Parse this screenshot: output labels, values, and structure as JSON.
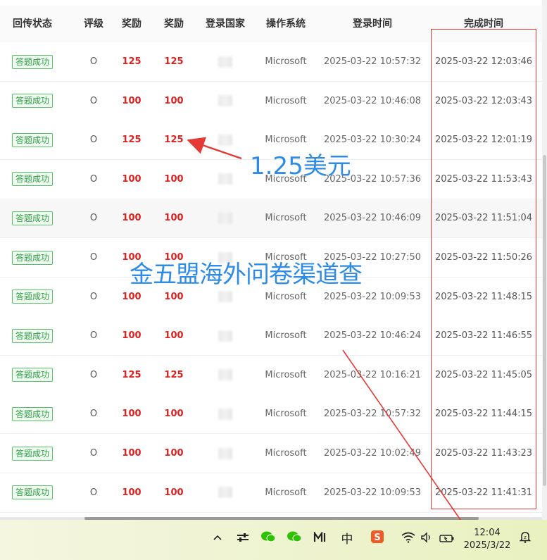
{
  "table": {
    "headers": {
      "status": "回传状态",
      "rating": "评级",
      "reward1": "奖励",
      "reward2": "奖励",
      "country": "登录国家",
      "os": "操作系统",
      "login_time": "登录时间",
      "complete_time": "完成时间"
    },
    "rows": [
      {
        "status": "答题成功",
        "rating": "O",
        "reward1": "125",
        "reward2": "125",
        "os": "Microsoft",
        "login_time": "2025-03-22 10:57:32",
        "complete_time": "2025-03-22 12:03:46"
      },
      {
        "status": "答题成功",
        "rating": "O",
        "reward1": "100",
        "reward2": "100",
        "os": "Microsoft",
        "login_time": "2025-03-22 10:46:08",
        "complete_time": "2025-03-22 12:03:43"
      },
      {
        "status": "答题成功",
        "rating": "O",
        "reward1": "125",
        "reward2": "125",
        "os": "Microsoft",
        "login_time": "2025-03-22 10:30:24",
        "complete_time": "2025-03-22 12:01:19"
      },
      {
        "status": "答题成功",
        "rating": "O",
        "reward1": "100",
        "reward2": "100",
        "os": "Microsoft",
        "login_time": "2025-03-22 10:57:36",
        "complete_time": "2025-03-22 11:53:43"
      },
      {
        "status": "答题成功",
        "rating": "O",
        "reward1": "100",
        "reward2": "100",
        "os": "Microsoft",
        "login_time": "2025-03-22 10:46:09",
        "complete_time": "2025-03-22 11:51:04"
      },
      {
        "status": "答题成功",
        "rating": "O",
        "reward1": "100",
        "reward2": "100",
        "os": "Microsoft",
        "login_time": "2025-03-22 10:27:50",
        "complete_time": "2025-03-22 11:50:26"
      },
      {
        "status": "答题成功",
        "rating": "O",
        "reward1": "100",
        "reward2": "100",
        "os": "Microsoft",
        "login_time": "2025-03-22 10:09:53",
        "complete_time": "2025-03-22 11:48:15"
      },
      {
        "status": "答题成功",
        "rating": "O",
        "reward1": "100",
        "reward2": "100",
        "os": "Microsoft",
        "login_time": "2025-03-22 10:46:24",
        "complete_time": "2025-03-22 11:46:55"
      },
      {
        "status": "答题成功",
        "rating": "O",
        "reward1": "125",
        "reward2": "125",
        "os": "Microsoft",
        "login_time": "2025-03-22 10:16:21",
        "complete_time": "2025-03-22 11:45:05"
      },
      {
        "status": "答题成功",
        "rating": "O",
        "reward1": "100",
        "reward2": "100",
        "os": "Microsoft",
        "login_time": "2025-03-22 10:57:32",
        "complete_time": "2025-03-22 11:44:15"
      },
      {
        "status": "答题成功",
        "rating": "O",
        "reward1": "100",
        "reward2": "100",
        "os": "Microsoft",
        "login_time": "2025-03-22 10:02:49",
        "complete_time": "2025-03-22 11:43:23"
      },
      {
        "status": "答题成功",
        "rating": "O",
        "reward1": "100",
        "reward2": "100",
        "os": "Microsoft",
        "login_time": "2025-03-22 10:09:53",
        "complete_time": "2025-03-22 11:41:31"
      }
    ]
  },
  "annotations": {
    "reward_note": "1.25美元",
    "watermark": "金五盟海外问卷渠道查"
  },
  "colors": {
    "reward": "#e0201e",
    "status_tag": "#2f9e44",
    "annotation_text": "#2e8ce6",
    "annotation_arrow": "#e53935"
  },
  "taskbar": {
    "icons": [
      "chevron-up-icon",
      "sliders-icon",
      "wechat-icon",
      "wechat-alt-icon",
      "app-m-icon",
      "ime-zhong-icon",
      "sogou-icon",
      "wifi-icon",
      "volume-icon",
      "battery-icon",
      "notification-bell-icon"
    ],
    "ime_label": "中",
    "time": "12:04",
    "date": "2025/3/22"
  }
}
